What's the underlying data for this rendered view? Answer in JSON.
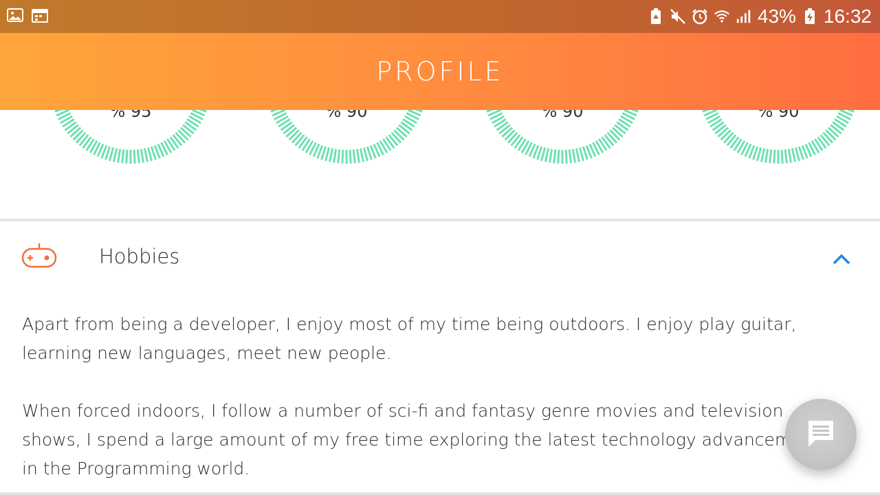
{
  "status_bar": {
    "battery": "43%",
    "time": "16:32",
    "left_icons": [
      "gallery-icon",
      "calendar-icon"
    ],
    "right_icons": [
      "battery-saver-icon",
      "mute-icon",
      "alarm-icon",
      "wifi-icon",
      "signal-icon",
      "battery-charging-icon"
    ]
  },
  "app_bar": {
    "title": "PROFILE"
  },
  "skills": [
    {
      "percent_label": "% 95",
      "value": 95
    },
    {
      "percent_label": "% 90",
      "value": 90
    },
    {
      "percent_label": "% 90",
      "value": 90
    },
    {
      "percent_label": "% 90",
      "value": 90
    }
  ],
  "hobbies": {
    "icon": "gamepad-icon",
    "title": "Hobbies",
    "toggle_icon": "chevron-up-icon",
    "paragraphs": [
      "Apart from being a developer, I enjoy most of my time being outdoors. I enjoy play guitar, learning new languages, meet new people.",
      "When forced indoors, I follow a number of sci-fi and fantasy genre movies and television shows, I spend a large amount of my free time exploring the latest technology advancements in the Programming world."
    ]
  },
  "fab": {
    "icon": "chat-icon"
  },
  "colors": {
    "accent_orange": "#ff8a3f",
    "gauge_green": "#6fe0b0",
    "link_blue": "#1e88e5",
    "status_bar": "#c0632f"
  }
}
